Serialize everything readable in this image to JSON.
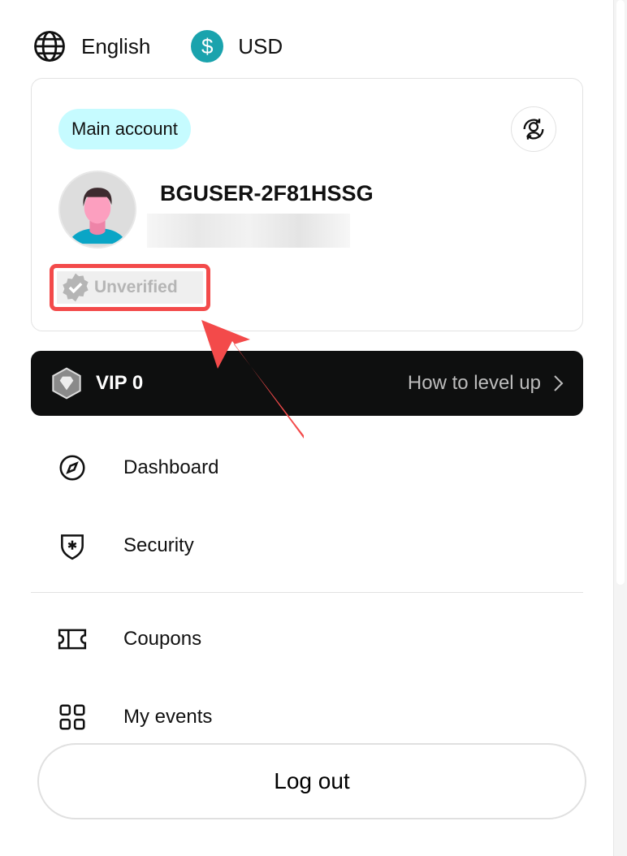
{
  "header": {
    "language": "English",
    "currency": "USD",
    "currency_symbol": "$"
  },
  "account": {
    "badge": "Main account",
    "username": "BGUSER-2F81HSSG",
    "verification_status": "Unverified"
  },
  "vip": {
    "label": "VIP 0",
    "level_up": "How to level up"
  },
  "menu": [
    {
      "label": "Dashboard",
      "icon": "compass-icon"
    },
    {
      "label": "Security",
      "icon": "shield-star-icon"
    },
    {
      "label": "Coupons",
      "icon": "ticket-icon"
    },
    {
      "label": "My events",
      "icon": "grid-icon"
    }
  ],
  "logout": "Log out",
  "colors": {
    "accent": "#1aa3ad",
    "badge_bg": "#c6fbff",
    "highlight": "#f34a4a",
    "vip_bg": "#0e0f0f"
  }
}
